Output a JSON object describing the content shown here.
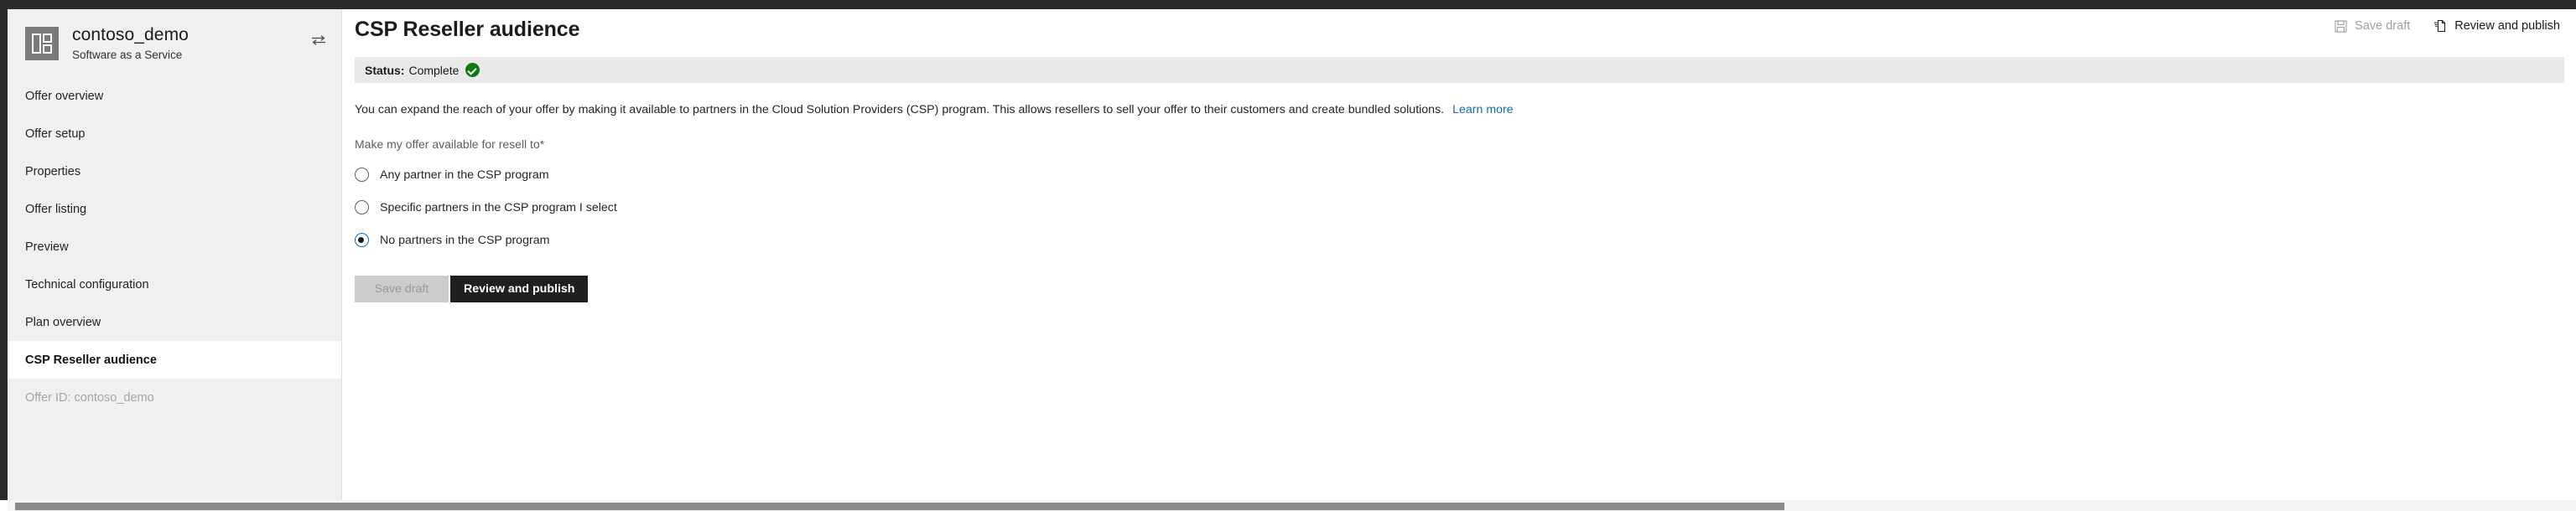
{
  "window": {
    "chrome_color": "#2b2b2b"
  },
  "sidebar": {
    "brand": {
      "title": "contoso_demo",
      "subtitle": "Software as a Service",
      "logo_icon": "grid-window-icon",
      "swap_icon": "swap-arrows-icon"
    },
    "items": [
      {
        "label": "Offer overview",
        "active": false
      },
      {
        "label": "Offer setup",
        "active": false
      },
      {
        "label": "Properties",
        "active": false
      },
      {
        "label": "Offer listing",
        "active": false
      },
      {
        "label": "Preview",
        "active": false
      },
      {
        "label": "Technical configuration",
        "active": false
      },
      {
        "label": "Plan overview",
        "active": false
      },
      {
        "label": "CSP Reseller audience",
        "active": true
      }
    ],
    "offer_id": "Offer ID: contoso_demo"
  },
  "header": {
    "title": "CSP Reseller audience",
    "actions": {
      "save_draft": {
        "label": "Save draft",
        "icon": "save-floppy-icon",
        "enabled": false
      },
      "review_publish": {
        "label": "Review and publish",
        "icon": "publish-document-icon",
        "enabled": true
      }
    }
  },
  "status": {
    "label": "Status:",
    "value": "Complete",
    "icon": "green-check-circle-icon",
    "color": "#107c10"
  },
  "main": {
    "description": "You can expand the reach of your offer by making it available to partners in the Cloud Solution Providers (CSP) program. This allows resellers to sell your offer to their customers and create bundled solutions.",
    "learn_more": "Learn more",
    "field_label": "Make my offer available for resell to*",
    "options": [
      {
        "label": "Any partner in the CSP program",
        "selected": false
      },
      {
        "label": "Specific partners in the CSP program I select",
        "selected": false
      },
      {
        "label": "No partners in the CSP program",
        "selected": true
      }
    ]
  },
  "footer": {
    "save_draft": "Save draft",
    "review_publish": "Review and publish"
  },
  "colors": {
    "accent": "#0f6cbd",
    "success": "#107c10",
    "primary_button": "#201f1e",
    "sidebar_bg": "#f0f0f0"
  }
}
